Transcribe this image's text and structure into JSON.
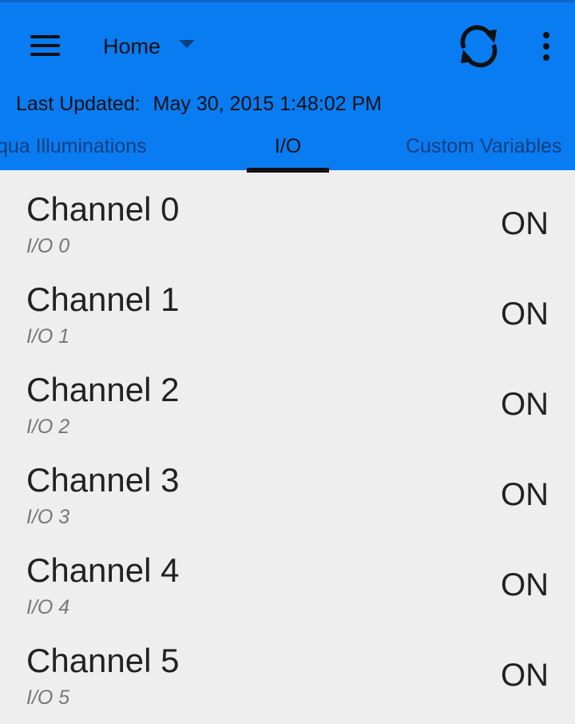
{
  "toolbar": {
    "spinner_label": "Home"
  },
  "status": {
    "last_updated_label": "Last Updated:",
    "last_updated_value": "May 30, 2015 1:48:02 PM"
  },
  "tabs": [
    {
      "label": "Aqua Illuminations",
      "visible_text": "qua Illuminations",
      "active": false
    },
    {
      "label": "I/O",
      "visible_text": "I/O",
      "active": true
    },
    {
      "label": "Custom Variables",
      "visible_text": "Custom Variables",
      "active": false
    }
  ],
  "channels": [
    {
      "name": "Channel 0",
      "subtitle": "I/O 0",
      "state": "ON"
    },
    {
      "name": "Channel 1",
      "subtitle": "I/O 1",
      "state": "ON"
    },
    {
      "name": "Channel 2",
      "subtitle": "I/O 2",
      "state": "ON"
    },
    {
      "name": "Channel 3",
      "subtitle": "I/O 3",
      "state": "ON"
    },
    {
      "name": "Channel 4",
      "subtitle": "I/O 4",
      "state": "ON"
    },
    {
      "name": "Channel 5",
      "subtitle": "I/O 5",
      "state": "ON"
    }
  ],
  "colors": {
    "appbar": "#0a7cf2",
    "content_background": "#eeeeee",
    "tab_indicator": "#111111",
    "inactive_tab_text": "#0e3f7c"
  },
  "icons": {
    "menu": "menu-icon",
    "dropdown": "dropdown-arrow-icon",
    "refresh": "refresh-icon",
    "overflow": "overflow-menu-icon"
  }
}
